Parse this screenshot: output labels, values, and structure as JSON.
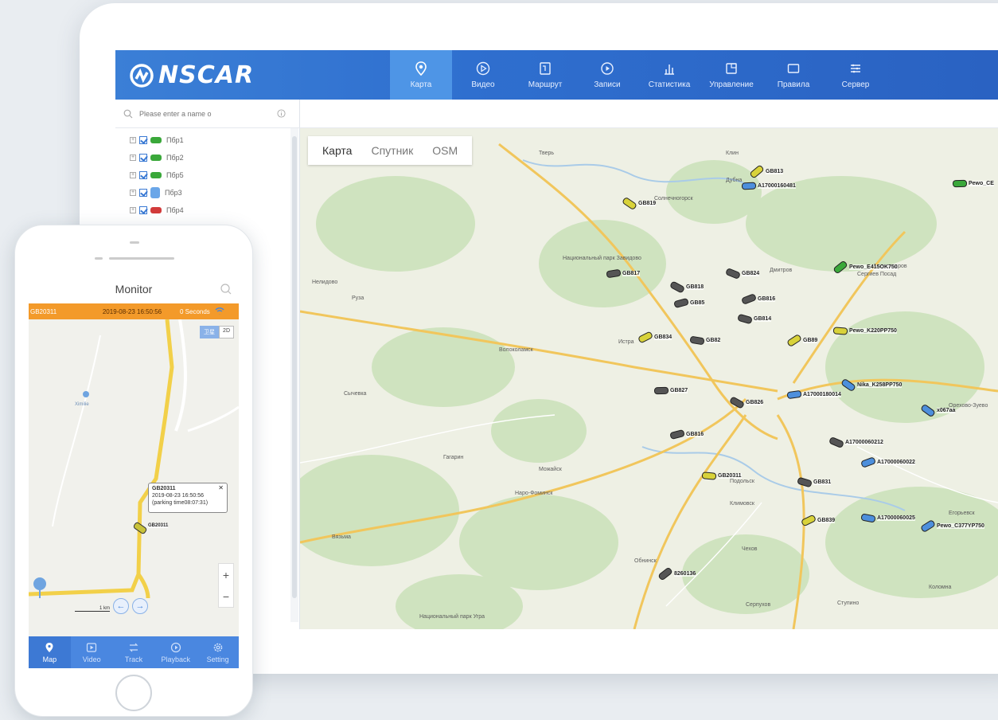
{
  "app": {
    "logo": "NSCAR",
    "nav": [
      {
        "label": "Карта",
        "icon": "map-pin-icon",
        "active": true
      },
      {
        "label": "Видео",
        "icon": "play-circle-icon"
      },
      {
        "label": "Маршрут",
        "icon": "route-icon"
      },
      {
        "label": "Записи",
        "icon": "playback-icon"
      },
      {
        "label": "Статистика",
        "icon": "bar-chart-icon"
      },
      {
        "label": "Управление",
        "icon": "manage-icon"
      },
      {
        "label": "Правила",
        "icon": "rules-icon"
      },
      {
        "label": "Сервер",
        "icon": "server-icon"
      }
    ]
  },
  "sidebar": {
    "search_placeholder": "Please enter a name o",
    "items": [
      {
        "label": "Пбр1",
        "color": "#3aa83a"
      },
      {
        "label": "Пбр2",
        "color": "#3aa83a"
      },
      {
        "label": "Пбр5",
        "color": "#3aa83a"
      },
      {
        "label": "Пбр3",
        "color": "#6aa6e8"
      },
      {
        "label": "Пбр4",
        "color": "#d23b3b"
      }
    ]
  },
  "map": {
    "tabs": [
      "Карта",
      "Спутник",
      "OSM"
    ],
    "places": [
      "Тверь",
      "Дубна",
      "Клин",
      "Солнечногорск",
      "Дмитров",
      "Сергиев Посад",
      "Волоколамск",
      "Истра",
      "Руза",
      "Наро-Фоминск",
      "Подольск",
      "Климовск",
      "Чехов",
      "Серпухов",
      "Обнинск",
      "Коломна",
      "Ступино",
      "Орехово-Зуево",
      "Егорьевск",
      "Можайск",
      "Гагарин",
      "Вязьма",
      "Сычевка",
      "Александров",
      "Нелидово",
      "Национальный парк Завидово",
      "Национальный парк Угра"
    ],
    "vehicles": [
      {
        "label": "GB813",
        "color": "yellow"
      },
      {
        "label": "A17000160481",
        "color": "blue"
      },
      {
        "label": "GB819",
        "color": "yellow"
      },
      {
        "label": "GB817",
        "color": "gray"
      },
      {
        "label": "GB818",
        "color": "gray"
      },
      {
        "label": "GB85",
        "color": "gray"
      },
      {
        "label": "GB824",
        "color": "gray"
      },
      {
        "label": "GB816",
        "color": "gray"
      },
      {
        "label": "GB814",
        "color": "gray"
      },
      {
        "label": "GB834",
        "color": "yellow"
      },
      {
        "label": "GB82",
        "color": "gray"
      },
      {
        "label": "GB89",
        "color": "yellow"
      },
      {
        "label": "Pewo_K220PP750",
        "color": "yellow"
      },
      {
        "label": "Pewo_E415OK750",
        "color": "green"
      },
      {
        "label": "GB827",
        "color": "gray"
      },
      {
        "label": "Nika_K258PP750",
        "color": "blue"
      },
      {
        "label": "A17000180014",
        "color": "blue"
      },
      {
        "label": "GB826",
        "color": "gray"
      },
      {
        "label": "GB816",
        "color": "gray"
      },
      {
        "label": "A17000060212",
        "color": "gray"
      },
      {
        "label": "A17000060022",
        "color": "blue"
      },
      {
        "label": "GB831",
        "color": "gray"
      },
      {
        "label": "GB839",
        "color": "yellow"
      },
      {
        "label": "A17000060025",
        "color": "blue"
      },
      {
        "label": "Pewo_C377YP750",
        "color": "blue"
      },
      {
        "label": "GB20311",
        "color": "yellow"
      },
      {
        "label": "8260136",
        "color": "gray"
      },
      {
        "label": "Pewo_CE",
        "color": "green"
      },
      {
        "label": "x067aa",
        "color": "blue"
      }
    ]
  },
  "phone": {
    "title": "Monitor",
    "status_id": "GB20311",
    "status_time": "2019-08-23 16:50:56",
    "status_speed": "0 Seconds",
    "toggle": [
      "卫星",
      "2D"
    ],
    "popup": {
      "line1": "GB20311",
      "line2": "2019-08-23 16:50:56",
      "line3": "(parking time08:07:31)"
    },
    "marker_label": "GB20311",
    "place": "Ximilie",
    "scale": "1 km",
    "tabs": [
      {
        "label": "Map",
        "icon": "map-pin-icon",
        "active": true
      },
      {
        "label": "Video",
        "icon": "play-icon"
      },
      {
        "label": "Track",
        "icon": "track-icon"
      },
      {
        "label": "Playback",
        "icon": "playback-icon"
      },
      {
        "label": "Setting",
        "icon": "gear-icon"
      }
    ]
  },
  "colors": {
    "nav_bg": "#2f6fcf",
    "phone_status_bar": "#f39a2a",
    "phone_tab_bar": "#4a87e0"
  }
}
